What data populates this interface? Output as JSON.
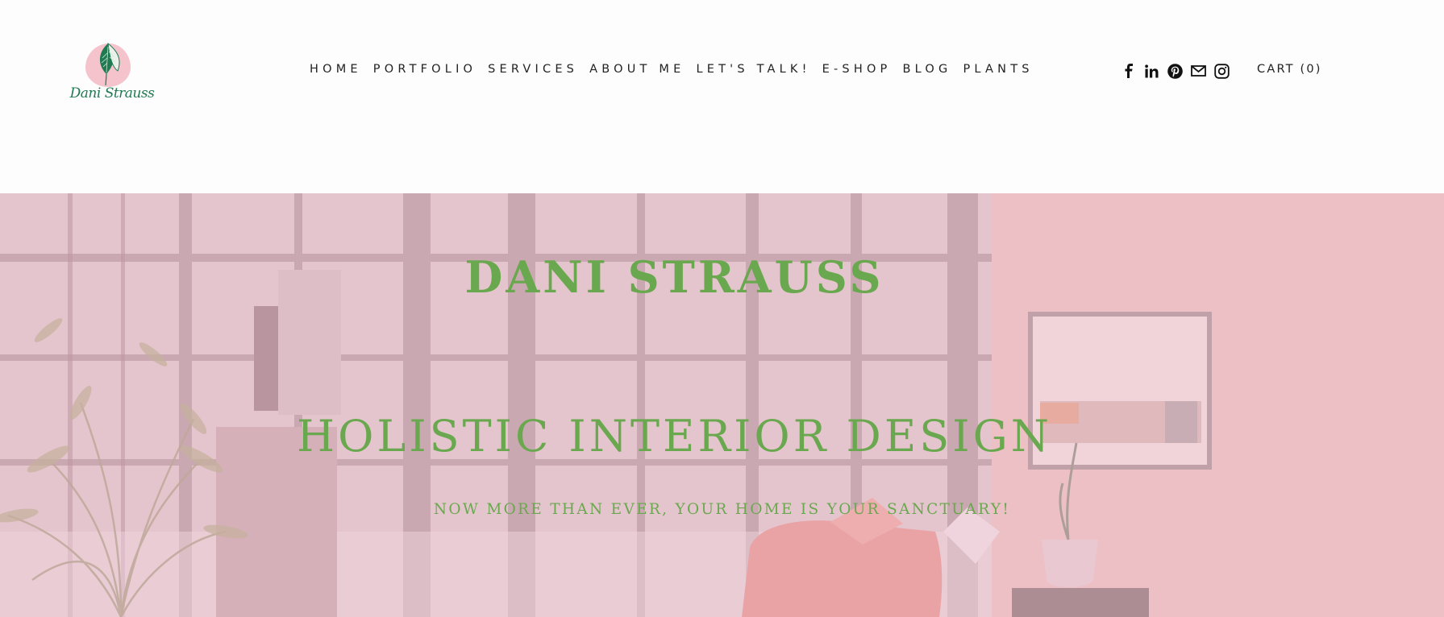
{
  "brand": {
    "logo_text": "Dani Strauss",
    "logo_blob_color": "#f4c3cc",
    "logo_text_color": "#1f7a52",
    "icon": "leaf-logo-icon"
  },
  "nav": {
    "items": [
      {
        "label": "HOME"
      },
      {
        "label": "PORTFOLIO"
      },
      {
        "label": "SERVICES"
      },
      {
        "label": "ABOUT ME"
      },
      {
        "label": "LET'S TALK!"
      },
      {
        "label": "E-SHOP"
      },
      {
        "label": "BLOG"
      },
      {
        "label": "PLANTS"
      }
    ]
  },
  "social": [
    "facebook-icon",
    "linkedin-icon",
    "pinterest-icon",
    "email-icon",
    "instagram-icon"
  ],
  "cart": {
    "label": "CART (0)"
  },
  "hero": {
    "title": "DANI STRAUSS",
    "subtitle": "HOLISTIC INTERIOR DESIGN",
    "tagline": "NOW MORE THAN EVER, YOUR HOME IS YOUR SANCTUARY!",
    "text_color": "#6aa84f",
    "overlay_color": "#dcb2bb"
  }
}
